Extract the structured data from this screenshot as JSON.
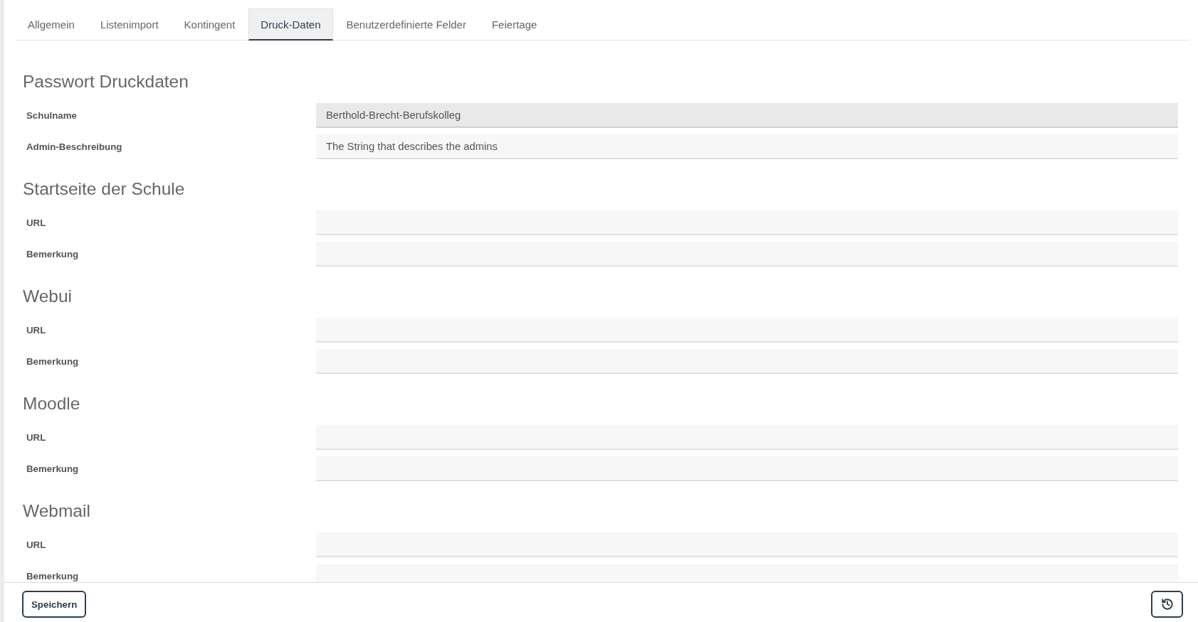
{
  "tabs": [
    {
      "label": "Allgemein",
      "selected": false
    },
    {
      "label": "Listenimport",
      "selected": false
    },
    {
      "label": "Kontingent",
      "selected": false
    },
    {
      "label": "Druck-Daten",
      "selected": true
    },
    {
      "label": "Benutzerdefinierte Felder",
      "selected": false
    },
    {
      "label": "Feiertage",
      "selected": false
    }
  ],
  "sections": [
    {
      "title": "Passwort Druckdaten",
      "fields": [
        {
          "label": "Schulname",
          "value": "Berthold-Brecht-Berufskolleg",
          "disabled": true
        },
        {
          "label": "Admin-Beschreibung",
          "value": "The String that describes the admins",
          "disabled": false
        }
      ]
    },
    {
      "title": "Startseite der Schule",
      "fields": [
        {
          "label": "URL",
          "disabled": false
        },
        {
          "label": "Bemerkung",
          "disabled": false
        }
      ]
    },
    {
      "title": "Webui",
      "fields": [
        {
          "label": "URL",
          "disabled": false
        },
        {
          "label": "Bemerkung",
          "disabled": false
        }
      ]
    },
    {
      "title": "Moodle",
      "fields": [
        {
          "label": "URL",
          "disabled": false
        },
        {
          "label": "Bemerkung",
          "disabled": false
        }
      ]
    },
    {
      "title": "Webmail",
      "fields": [
        {
          "label": "URL",
          "disabled": false
        },
        {
          "label": "Bemerkung",
          "disabled": false
        }
      ]
    }
  ],
  "footer": {
    "save_button": "Speichern"
  }
}
